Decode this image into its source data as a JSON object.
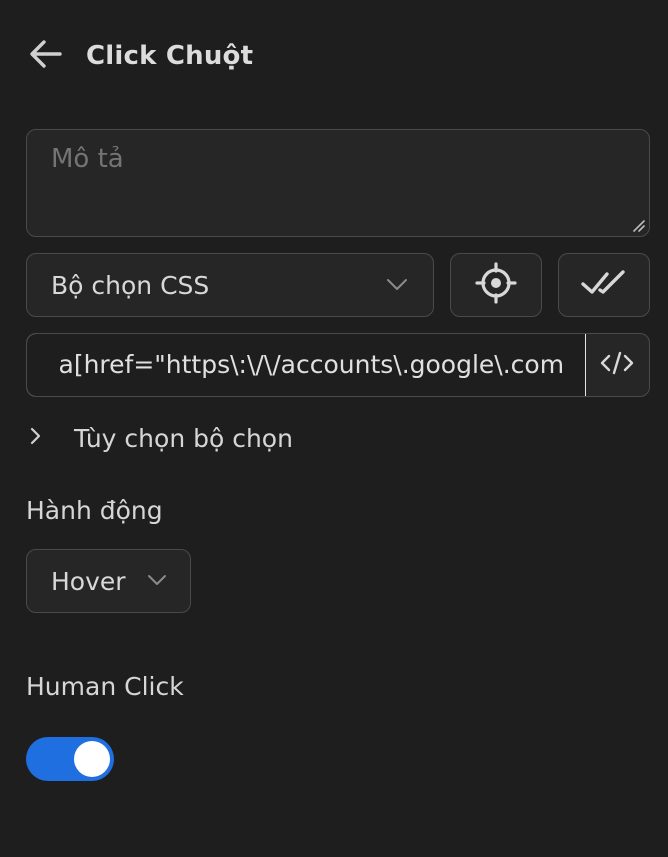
{
  "header": {
    "title": "Click Chuột",
    "back_icon": "arrow-left-icon"
  },
  "description": {
    "placeholder": "Mô tả",
    "value": ""
  },
  "selector_type": {
    "selected": "Bộ chọn CSS"
  },
  "selector_value": "a[href=\"https\\:\\/\\/accounts\\.google\\.com",
  "selector_options": {
    "label": "Tùy chọn bộ chọn",
    "expanded": false
  },
  "action": {
    "label": "Hành động",
    "selected": "Hover"
  },
  "human_click": {
    "label": "Human Click",
    "enabled": true
  },
  "colors": {
    "background": "#1e1e1e",
    "toggle_on": "#1f6fe0"
  }
}
